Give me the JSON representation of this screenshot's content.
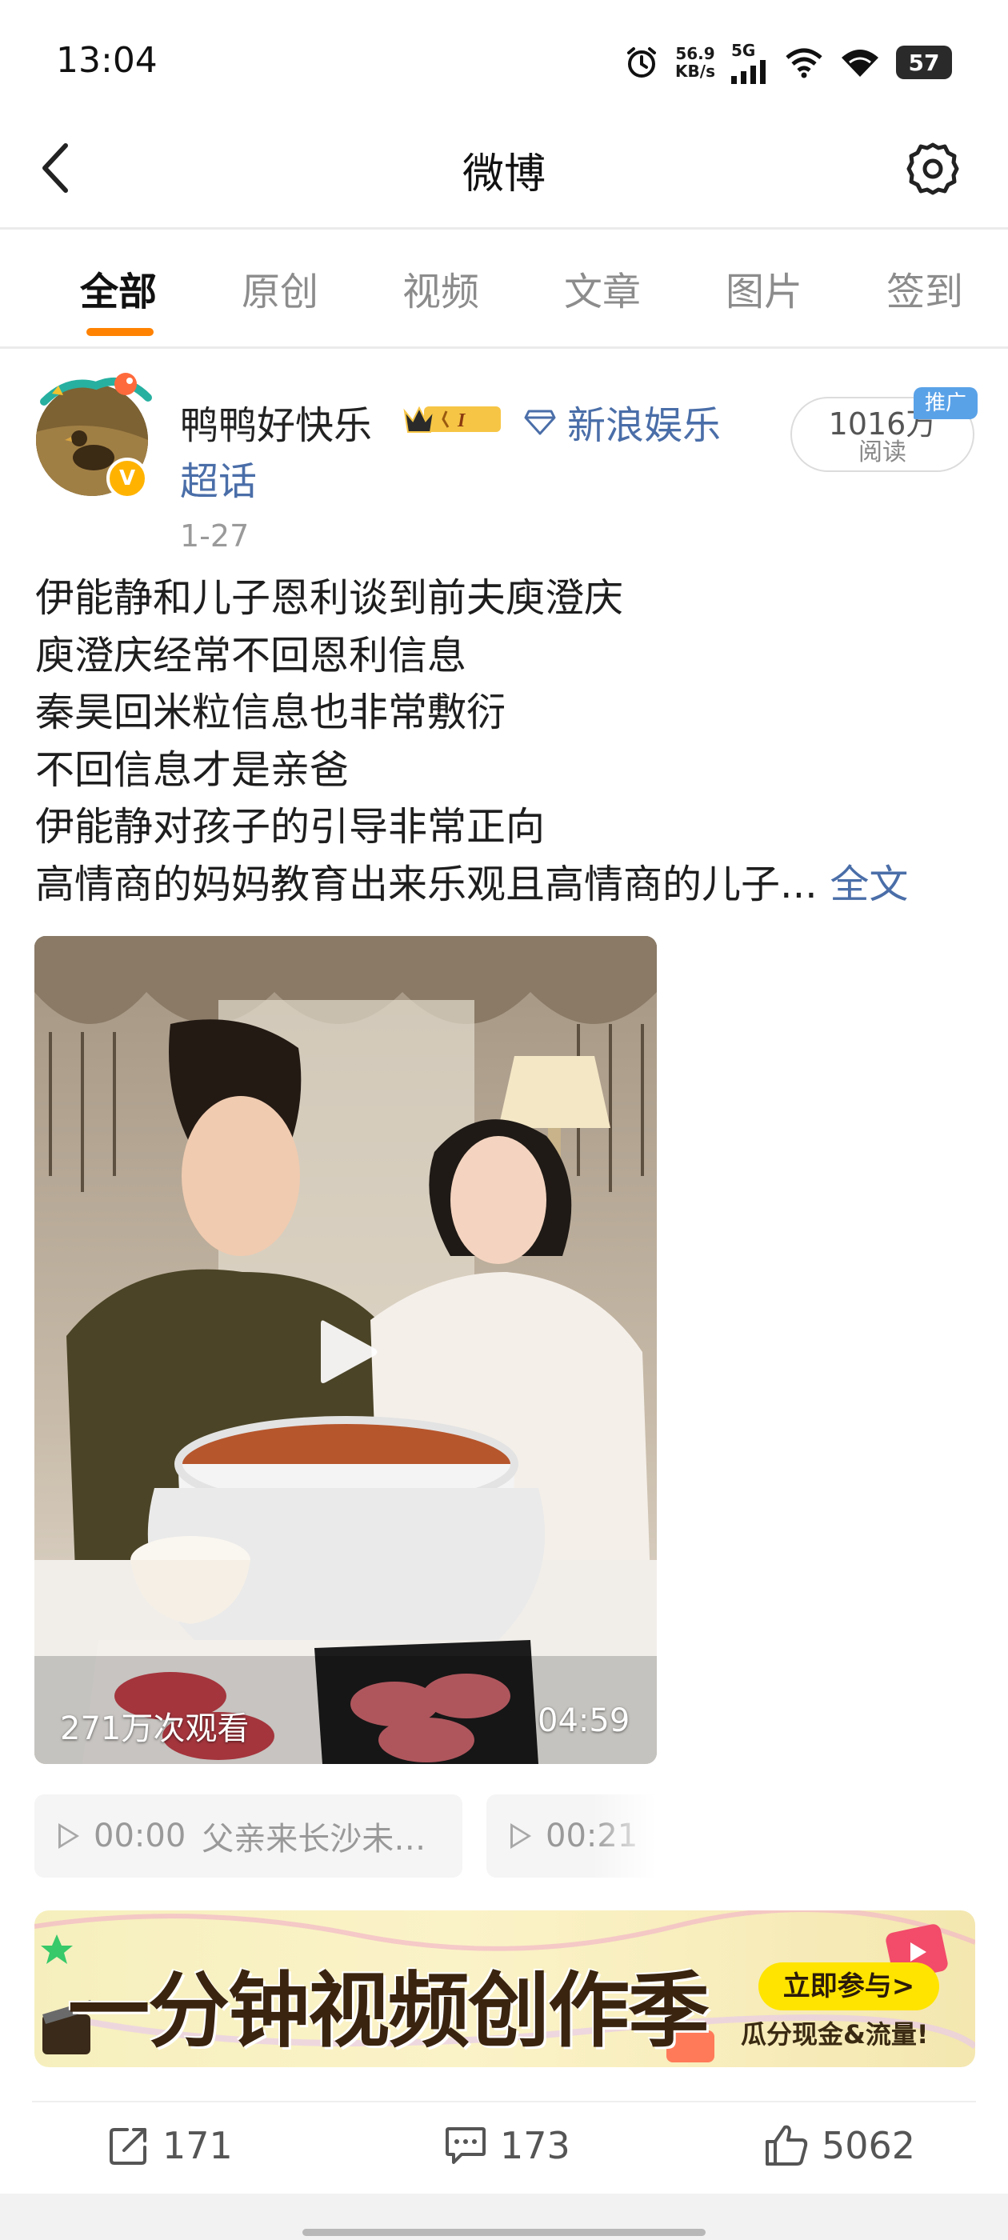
{
  "status_bar": {
    "time": "13:04",
    "net_speed_value": "56.9",
    "net_speed_unit": "KB/s",
    "network_type": "5G",
    "battery_level": "57",
    "icons": [
      "alarm-icon",
      "signal-icon",
      "wifi-icon",
      "wifi-icon",
      "battery-icon"
    ]
  },
  "nav": {
    "title": "微博",
    "back_icon": "chevron-left-icon",
    "settings_icon": "gear-icon"
  },
  "tabs": [
    {
      "label": "全部",
      "active": true
    },
    {
      "label": "原创",
      "active": false
    },
    {
      "label": "视频",
      "active": false
    },
    {
      "label": "文章",
      "active": false
    },
    {
      "label": "图片",
      "active": false
    },
    {
      "label": "签到",
      "active": false
    }
  ],
  "colors": {
    "accent": "#ff8200",
    "link": "#4a6ea8",
    "promo": "#5aa2e8",
    "cta": "#ffe400"
  },
  "post": {
    "user_name": "鸭鸭好快乐",
    "source_line1": "新浪娱乐",
    "source_line2": "超话",
    "date": "1-27",
    "read_count": "1016万",
    "read_label": "阅读",
    "promo_tag": "推广",
    "text_lines": [
      "伊能静和儿子恩利谈到前夫庾澄庆",
      "庾澄庆经常不回恩利信息",
      "秦昊回米粒信息也非常敷衍",
      "不回信息才是亲爸",
      "伊能静对孩子的引导非常正向",
      "高情商的妈妈教育出来乐观且高情商的儿子..."
    ],
    "full_text_link": "全文",
    "video": {
      "views": "271万次观看",
      "duration": "04:59"
    },
    "chapters": [
      {
        "time": "00:00",
        "title": "父亲来长沙未…"
      },
      {
        "time": "00:21",
        "title": ""
      }
    ],
    "banner": {
      "title": "一分钟视频创作季",
      "cta": "立即参与>",
      "subtitle": "瓜分现金&流量!"
    },
    "actions": {
      "reposts": "171",
      "comments": "173",
      "likes": "5062"
    }
  }
}
